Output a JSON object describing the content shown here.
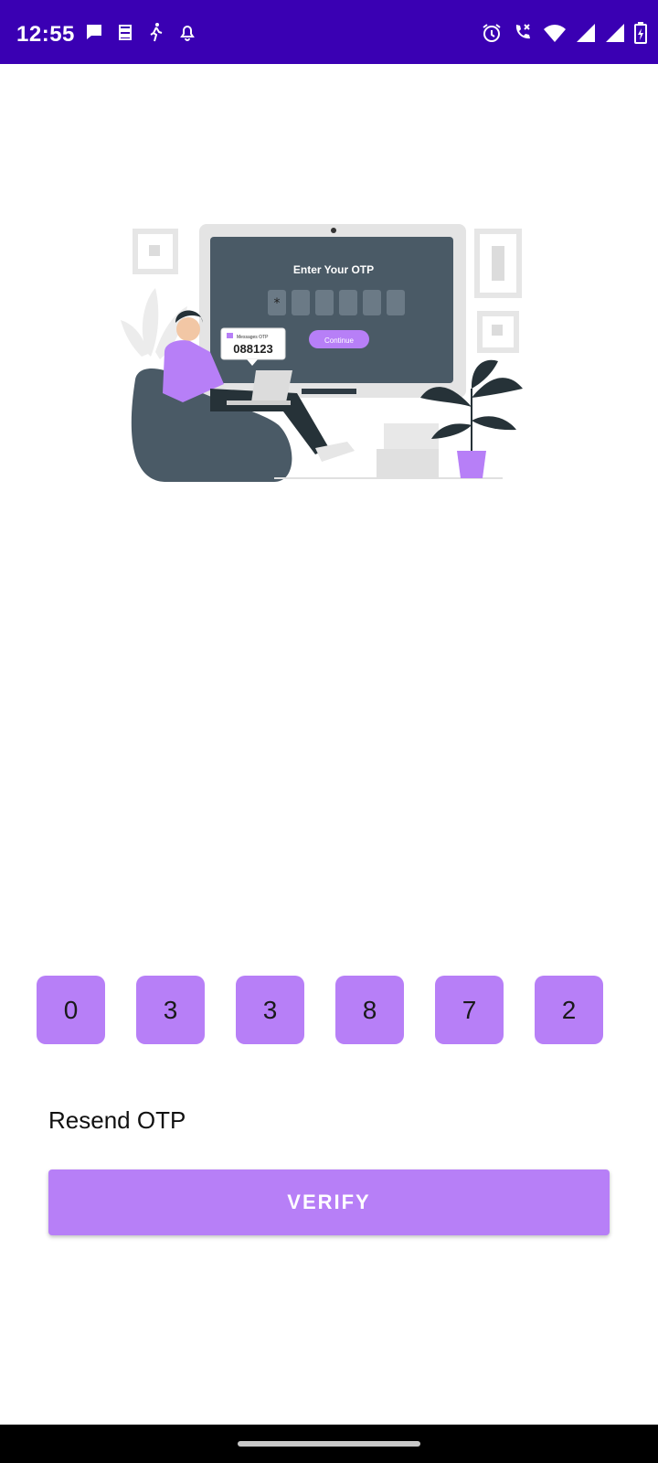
{
  "status_bar": {
    "time": "12:55",
    "left_icons": [
      "chat-bubble-icon",
      "vpn-key-icon",
      "walking-icon",
      "notification-bell-icon"
    ],
    "right_icons": [
      "alarm-icon",
      "wifi-calling-icon",
      "wifi-icon",
      "signal-icon",
      "signal-icon",
      "battery-charging-icon"
    ],
    "background": "#3a00b3"
  },
  "illustration": {
    "screen_title": "Enter Your OTP",
    "continue_label": "Continue",
    "message_label": "Messages OTP",
    "message_code": "088123",
    "otp_mask_char": "*",
    "accent": "#b77ff7"
  },
  "otp": {
    "digits": [
      "0",
      "3",
      "3",
      "8",
      "7",
      "2"
    ]
  },
  "resend_label": "Resend OTP",
  "verify_label": "VERIFY",
  "colors": {
    "accent": "#b77ff7",
    "status_bar": "#3a00b3"
  }
}
